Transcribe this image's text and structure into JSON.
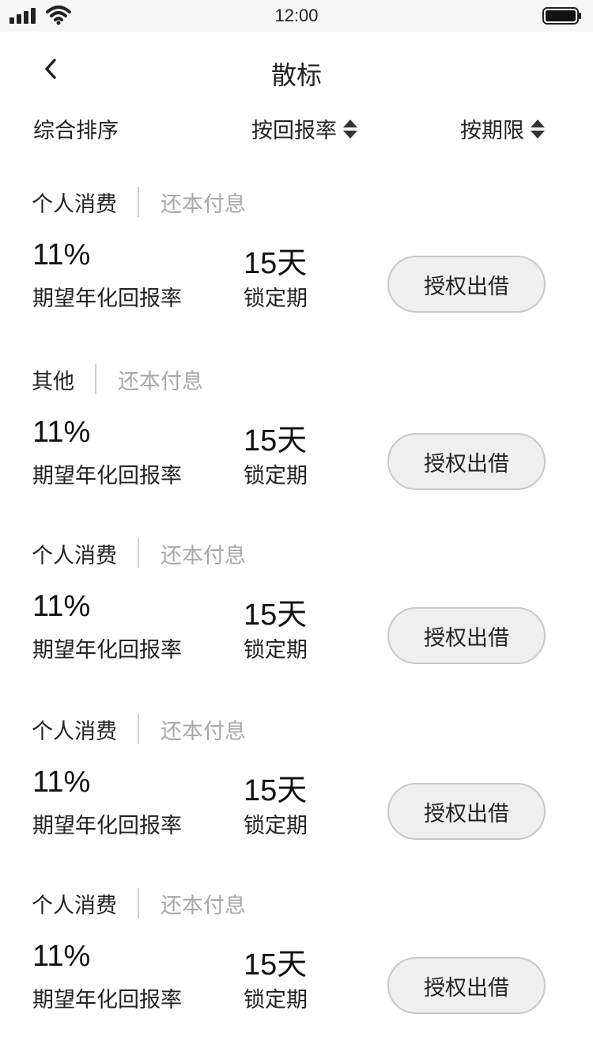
{
  "status_bar": {
    "time": "12:00"
  },
  "nav": {
    "title": "散标"
  },
  "sort": {
    "comprehensive": "综合排序",
    "by_rate": "按回报率",
    "by_term": "按期限"
  },
  "cards": [
    {
      "type": "个人消费",
      "repay": "还本付息",
      "rate": "11%",
      "rate_label": "期望年化回报率",
      "term": "15天",
      "term_label": "锁定期",
      "button": "授权出借"
    },
    {
      "type": "其他",
      "repay": "还本付息",
      "rate": "11%",
      "rate_label": "期望年化回报率",
      "term": "15天",
      "term_label": "锁定期",
      "button": "授权出借"
    },
    {
      "type": "个人消费",
      "repay": "还本付息",
      "rate": "11%",
      "rate_label": "期望年化回报率",
      "term": "15天",
      "term_label": "锁定期",
      "button": "授权出借"
    },
    {
      "type": "个人消费",
      "repay": "还本付息",
      "rate": "11%",
      "rate_label": "期望年化回报率",
      "term": "15天",
      "term_label": "锁定期",
      "button": "授权出借"
    },
    {
      "type": "个人消费",
      "repay": "还本付息",
      "rate": "11%",
      "rate_label": "期望年化回报率",
      "term": "15天",
      "term_label": "锁定期",
      "button": "授权出借"
    }
  ]
}
